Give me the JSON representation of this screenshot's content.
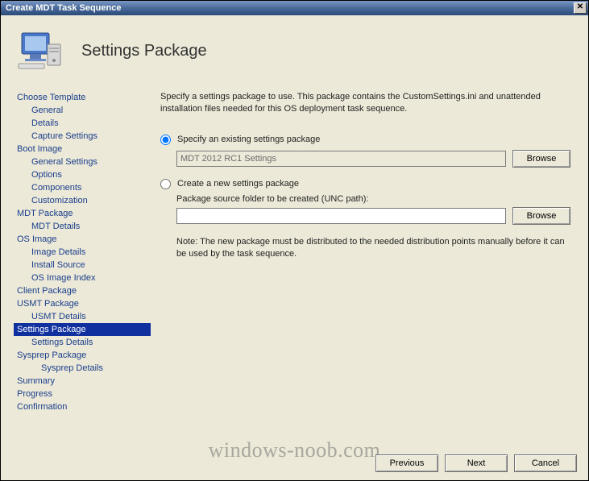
{
  "window": {
    "title": "Create MDT Task Sequence"
  },
  "header": {
    "page_title": "Settings Package"
  },
  "nav": {
    "choose_template": "Choose Template",
    "general": "General",
    "details": "Details",
    "capture_settings": "Capture Settings",
    "boot_image": "Boot Image",
    "general_settings": "General Settings",
    "options": "Options",
    "components": "Components",
    "customization": "Customization",
    "mdt_package": "MDT Package",
    "mdt_details": "MDT Details",
    "os_image": "OS Image",
    "image_details": "Image Details",
    "install_source": "Install Source",
    "os_image_index": "OS Image Index",
    "client_package": "Client Package",
    "usmt_package": "USMT Package",
    "usmt_details": "USMT Details",
    "settings_package": "Settings Package",
    "settings_details": "Settings Details",
    "sysprep_package": "Sysprep Package",
    "sysprep_details": "Sysprep Details",
    "summary": "Summary",
    "progress": "Progress",
    "confirmation": "Confirmation"
  },
  "main": {
    "intro": "Specify a settings package to use.  This package contains the CustomSettings.ini and unattended installation files needed for this OS deployment task sequence.",
    "radio_existing": "Specify an existing settings package",
    "existing_value": "MDT 2012 RC1 Settings",
    "browse1": "Browse",
    "radio_new": "Create a new settings package",
    "unc_label": "Package source folder to be created (UNC path):",
    "unc_value": "",
    "browse2": "Browse",
    "note": "Note: The new package must be distributed to the needed distribution points manually before it can be used by the task sequence."
  },
  "footer": {
    "previous": "Previous",
    "next": "Next",
    "cancel": "Cancel"
  },
  "watermark": "windows-noob.com"
}
